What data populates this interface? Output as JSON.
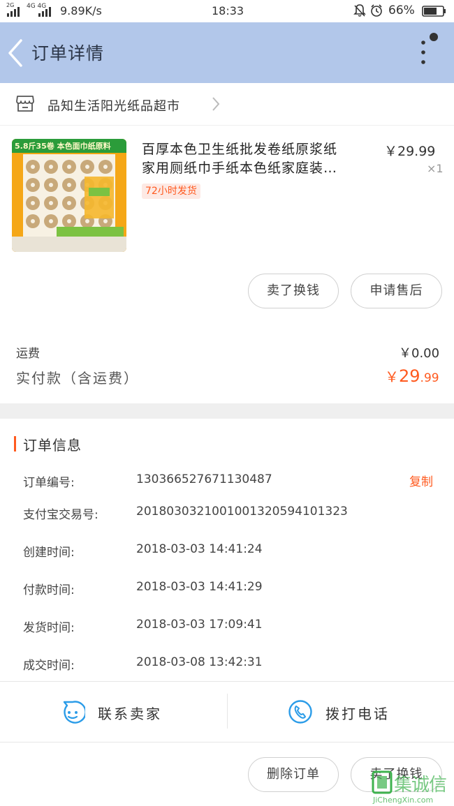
{
  "status_bar": {
    "network_left": "2G",
    "network_mid": "4G 4G",
    "speed": "9.89K/s",
    "time": "18:33",
    "battery": "66%"
  },
  "nav": {
    "title": "订单详情"
  },
  "shop": {
    "name": "品知生活阳光纸品超市"
  },
  "product": {
    "title_line1": "百厚本色卫生纸批发卷纸原浆纸",
    "title_line2": "家用厕纸巾手纸本色纸家庭装…",
    "price": "￥29.99",
    "quantity": "×1",
    "tag": "72小时发货",
    "image_banner": "5.8斤35卷  本色面巾纸原料"
  },
  "actions": {
    "sell_exchange": "卖了换钱",
    "after_sale": "申请售后"
  },
  "fees": {
    "shipping_label": "运费",
    "shipping_value": "￥0.00",
    "paid_label": "实付款（含运费）",
    "paid_currency": "￥",
    "paid_main": "29",
    "paid_decimal": ".99"
  },
  "order_info": {
    "heading": "订单信息",
    "copy_label": "复制",
    "rows": [
      {
        "label": "订单编号:",
        "value": "130366527671130487"
      },
      {
        "label": "支付宝交易号:",
        "value": "2018030321001001320594101323"
      },
      {
        "label": "创建时间:",
        "value": "2018-03-03 14:41:24"
      },
      {
        "label": "付款时间:",
        "value": "2018-03-03 14:41:29"
      },
      {
        "label": "发货时间:",
        "value": "2018-03-03 17:09:41"
      },
      {
        "label": "成交时间:",
        "value": "2018-03-08 13:42:31"
      }
    ]
  },
  "contact": {
    "seller": "联系卖家",
    "call": "拨打电话"
  },
  "bottom": {
    "delete_order": "删除订单",
    "sell_exchange": "卖了换钱"
  },
  "watermark": {
    "brand": "集诚信",
    "url": "JiChengXin.com"
  },
  "colors": {
    "accent": "#ff5a1f",
    "nav_bg": "#b2c7ea",
    "icon_blue": "#2b9ce8"
  }
}
